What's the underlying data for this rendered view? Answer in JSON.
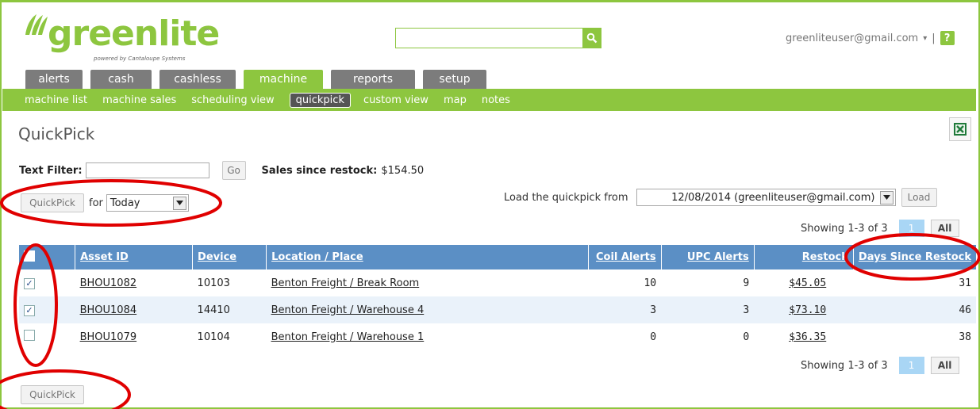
{
  "logo": {
    "text": "greenlite",
    "tm": "™",
    "tagline": "powered by Cantaloupe Systems"
  },
  "search": {
    "value": "",
    "placeholder": ""
  },
  "user": {
    "email": "greenliteuser@gmail.com",
    "caret": "▾",
    "separator": "|",
    "help": "?"
  },
  "tabs": [
    {
      "label": "alerts"
    },
    {
      "label": "cash"
    },
    {
      "label": "cashless"
    },
    {
      "label": "machine"
    },
    {
      "label": "reports"
    },
    {
      "label": "setup"
    }
  ],
  "subnav": [
    {
      "label": "machine list"
    },
    {
      "label": "machine sales"
    },
    {
      "label": "scheduling view"
    },
    {
      "label": "quickpick"
    },
    {
      "label": "custom view"
    },
    {
      "label": "map"
    },
    {
      "label": "notes"
    }
  ],
  "page": {
    "title": "QuickPick"
  },
  "filter": {
    "label": "Text Filter:",
    "value": "",
    "go": "Go",
    "sales_label": "Sales since restock:",
    "sales_value": "$154.50"
  },
  "quickpick": {
    "button": "QuickPick",
    "for": "for",
    "period": "Today"
  },
  "load": {
    "label": "Load the quickpick from",
    "selected": "12/08/2014 (greenliteuser@gmail.com)",
    "button": "Load"
  },
  "paging": {
    "showing": "Showing 1-3 of 3",
    "page": "1",
    "all": "All"
  },
  "table": {
    "headers": [
      "Asset ID",
      "Device",
      "Location / Place",
      "Coil Alerts",
      "UPC Alerts",
      "Restock",
      "Days Since Restock"
    ],
    "rows": [
      {
        "checked": true,
        "asset": "BHOU1082",
        "device": "10103",
        "location": "Benton Freight / Break Room",
        "coil": "10",
        "upc": "9",
        "restock": "$45.05",
        "days": "31"
      },
      {
        "checked": true,
        "asset": "BHOU1084",
        "device": "14410",
        "location": "Benton Freight / Warehouse 4",
        "coil": "3",
        "upc": "3",
        "restock": "$73.10",
        "days": "46"
      },
      {
        "checked": false,
        "asset": "BHOU1079",
        "device": "10104",
        "location": "Benton Freight / Warehouse 1",
        "coil": "0",
        "upc": "0",
        "restock": "$36.35",
        "days": "38"
      }
    ]
  },
  "bottom": {
    "button": "QuickPick"
  },
  "colors": {
    "brand_green": "#8dc63f",
    "tab_gray": "#7c7c7c",
    "header_blue": "#5b8fc5",
    "annotation_red": "#e00000"
  },
  "icons": {
    "search": "search-icon",
    "help": "help-icon",
    "excel": "excel-icon",
    "dropdown": "chevron-down-icon"
  }
}
